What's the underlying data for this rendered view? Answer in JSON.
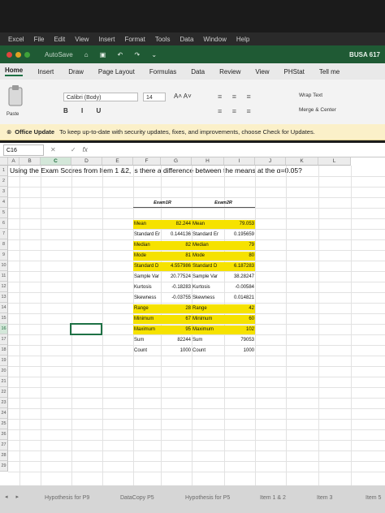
{
  "mac_menu": [
    "Excel",
    "File",
    "Edit",
    "View",
    "Insert",
    "Format",
    "Tools",
    "Data",
    "Window",
    "Help"
  ],
  "window": {
    "autosave": "AutoSave",
    "doc_name": "BUSA 617"
  },
  "ribbon_tabs": [
    "Home",
    "Insert",
    "Draw",
    "Page Layout",
    "Formulas",
    "Data",
    "Review",
    "View",
    "PHStat",
    "Tell me"
  ],
  "ribbon": {
    "paste_label": "Paste",
    "font_name": "Calibri (Body)",
    "font_size": "14",
    "format_buttons": "B I U",
    "grow_shrink": "A˄ A˅",
    "wrap_text": "Wrap Text",
    "merge_center": "Merge & Center"
  },
  "notice": {
    "title": "Office Update",
    "message": "To keep up-to-date with security updates, fixes, and improvements, choose Check for Updates."
  },
  "formula_bar": {
    "name_box": "C16",
    "fx": "fx",
    "value": ""
  },
  "columns": [
    "A",
    "B",
    "C",
    "D",
    "E",
    "F",
    "G",
    "H",
    "I",
    "J",
    "K",
    "L"
  ],
  "rows": [
    "1",
    "2",
    "3",
    "4",
    "5",
    "6",
    "7",
    "8",
    "9",
    "10",
    "11",
    "12",
    "13",
    "14",
    "15",
    "16",
    "17",
    "18",
    "19",
    "20",
    "21",
    "22",
    "23",
    "24",
    "25",
    "26",
    "27",
    "28",
    "29"
  ],
  "question": "Using the Exam Scores from Item 1 &2, is there a difference between the means at the α=0.05?",
  "stats": {
    "header1": "Exam1R",
    "header2": "Exam2R",
    "rows": [
      {
        "l1": "Mean",
        "v1": "82.244",
        "l2": "Mean",
        "v2": "79.053",
        "hl": true
      },
      {
        "l1": "Standard Er",
        "v1": "0.144136",
        "l2": "Standard Er",
        "v2": "0.195659",
        "hl": false
      },
      {
        "l1": "Median",
        "v1": "82",
        "l2": "Median",
        "v2": "79",
        "hl": true
      },
      {
        "l1": "Mode",
        "v1": "81",
        "l2": "Mode",
        "v2": "80",
        "hl": true
      },
      {
        "l1": "Standard D",
        "v1": "4.557986",
        "l2": "Standard D",
        "v2": "6.187283",
        "hl": true
      },
      {
        "l1": "Sample Var",
        "v1": "20.77524",
        "l2": "Sample Var",
        "v2": "38.28247",
        "hl": false
      },
      {
        "l1": "Kurtosis",
        "v1": "-0.18283",
        "l2": "Kurtosis",
        "v2": "-0.00584",
        "hl": false
      },
      {
        "l1": "Skewness",
        "v1": "-0.03755",
        "l2": "Skewness",
        "v2": "0.014821",
        "hl": false
      },
      {
        "l1": "Range",
        "v1": "28",
        "l2": "Range",
        "v2": "42",
        "hl": true
      },
      {
        "l1": "Minimum",
        "v1": "67",
        "l2": "Minimum",
        "v2": "60",
        "hl": true
      },
      {
        "l1": "Maximum",
        "v1": "95",
        "l2": "Maximum",
        "v2": "102",
        "hl": true
      },
      {
        "l1": "Sum",
        "v1": "82244",
        "l2": "Sum",
        "v2": "79053",
        "hl": false
      },
      {
        "l1": "Count",
        "v1": "1000",
        "l2": "Count",
        "v2": "1000",
        "hl": false
      }
    ]
  },
  "sheet_tabs": [
    "Hypothesis for P9",
    "DataCopy P5",
    "Hypothesis for P5",
    "Item 1 & 2",
    "Item 3",
    "Item 5"
  ],
  "colors": {
    "excel_green": "#1f5a34",
    "highlight": "#f6e200",
    "notice_bg": "#fbf0c9"
  }
}
